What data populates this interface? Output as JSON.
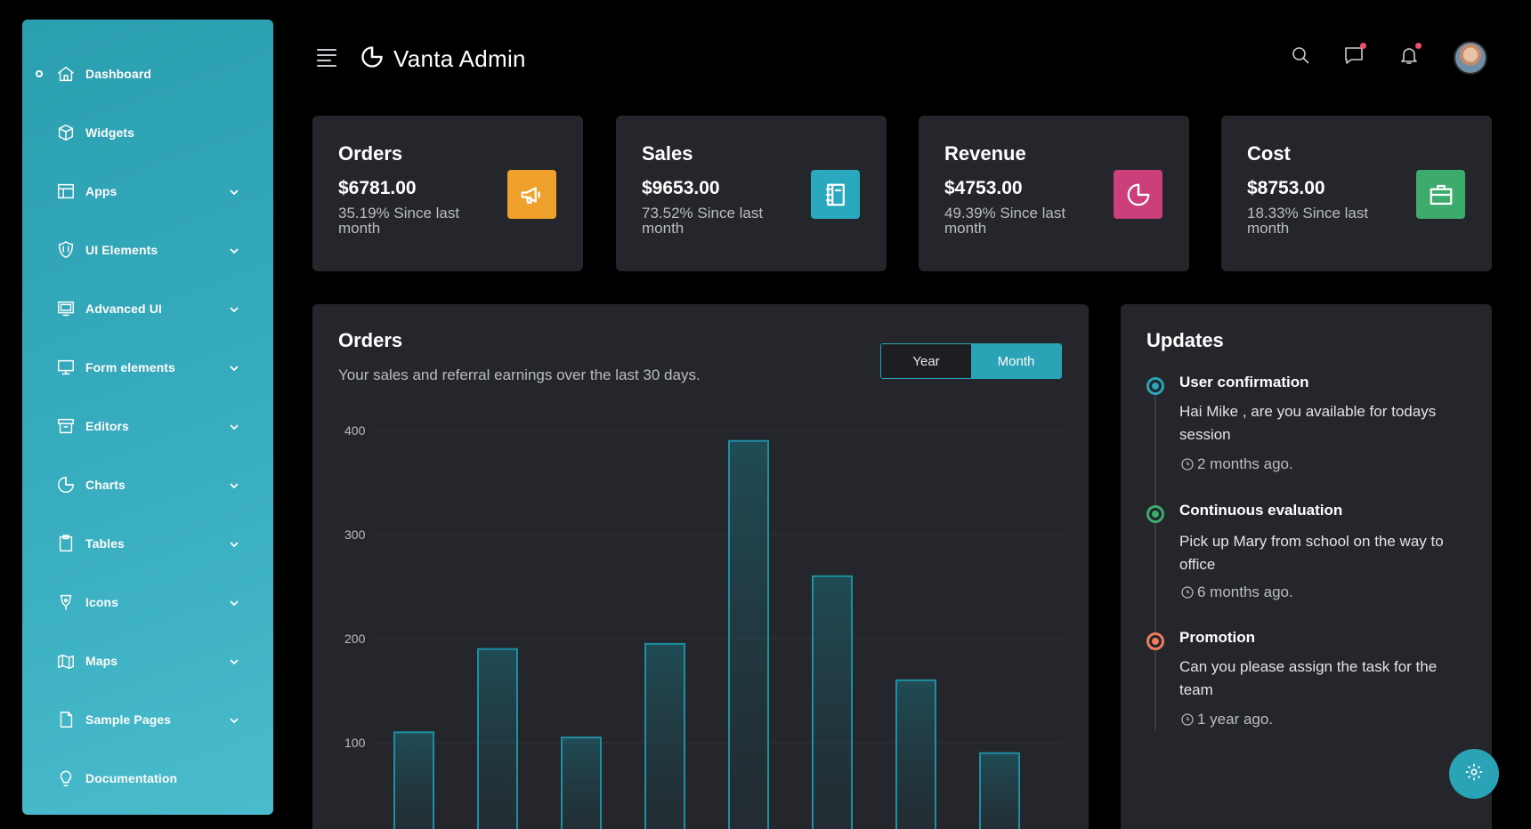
{
  "sidebar": {
    "items": [
      {
        "label": "Dashboard",
        "icon": "home-icon",
        "active": true,
        "has_submenu": false
      },
      {
        "label": "Widgets",
        "icon": "box-icon",
        "has_submenu": false
      },
      {
        "label": "Apps",
        "icon": "layout-icon",
        "has_submenu": true
      },
      {
        "label": "UI Elements",
        "icon": "shield-icon",
        "has_submenu": true
      },
      {
        "label": "Advanced UI",
        "icon": "monitor-icon",
        "has_submenu": true
      },
      {
        "label": "Form elements",
        "icon": "display-icon",
        "has_submenu": true
      },
      {
        "label": "Editors",
        "icon": "archive-icon",
        "has_submenu": true
      },
      {
        "label": "Charts",
        "icon": "pie-chart-icon",
        "has_submenu": true
      },
      {
        "label": "Tables",
        "icon": "clipboard-icon",
        "has_submenu": true
      },
      {
        "label": "Icons",
        "icon": "pen-icon",
        "has_submenu": true
      },
      {
        "label": "Maps",
        "icon": "map-icon",
        "has_submenu": true
      },
      {
        "label": "Sample Pages",
        "icon": "file-icon",
        "has_submenu": true
      },
      {
        "label": "Documentation",
        "icon": "bulb-icon",
        "has_submenu": false
      }
    ]
  },
  "header": {
    "brand": "Vanta Admin",
    "brand_icon": "pie-chart-icon",
    "icons": [
      "search-icon",
      "message-icon",
      "bell-icon"
    ]
  },
  "stats": [
    {
      "title": "Orders",
      "value": "$6781.00",
      "sub": "35.19% Since last month",
      "icon": "megaphone-icon",
      "color": "#f0a12c"
    },
    {
      "title": "Sales",
      "value": "$9653.00",
      "sub": "73.52% Since last month",
      "icon": "book-icon",
      "color": "#2aa8bd"
    },
    {
      "title": "Revenue",
      "value": "$4753.00",
      "sub": "49.39% Since last month",
      "icon": "pie-chart-icon",
      "color": "#cc3f7a"
    },
    {
      "title": "Cost",
      "value": "$8753.00",
      "sub": "18.33% Since last month",
      "icon": "briefcase-icon",
      "color": "#3cab6c"
    }
  ],
  "orders_card": {
    "title": "Orders",
    "subtitle": "Your sales and referral earnings over the last 30 days.",
    "toggle": {
      "year": "Year",
      "month": "Month",
      "selected": "Month"
    }
  },
  "chart_data": {
    "type": "bar",
    "title": "",
    "xlabel": "",
    "ylabel": "",
    "ylim": [
      0,
      400
    ],
    "yticks": [
      100,
      200,
      300,
      400
    ],
    "values": [
      110,
      190,
      105,
      195,
      390,
      260,
      160,
      90
    ],
    "grid": true,
    "bar_color": "#1e8fa2"
  },
  "updates": {
    "title": "Updates",
    "items": [
      {
        "title": "User confirmation",
        "body": "Hai Mike , are you available for todays session",
        "time": "2 months ago.",
        "color": "#2aa3b7"
      },
      {
        "title": "Continuous evaluation",
        "body": "Pick up Mary from school on the way to office",
        "time": "6 months ago.",
        "color": "#3cab6c"
      },
      {
        "title": "Promotion",
        "body": "Can you please assign the task for the team",
        "time": "1 year ago.",
        "color": "#f07b5f"
      }
    ]
  },
  "fab": {
    "icon": "settings-icon"
  }
}
